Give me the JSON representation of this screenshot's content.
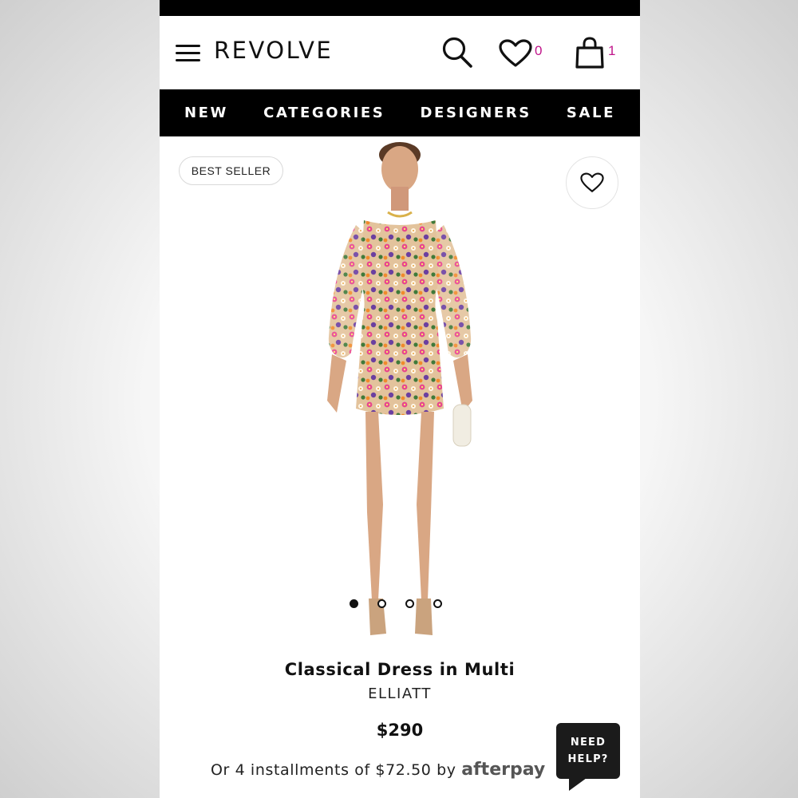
{
  "header": {
    "logo": "REVOLVE",
    "wishlist_count": "0",
    "cart_count": "1"
  },
  "nav": {
    "items": [
      "NEW",
      "CATEGORIES",
      "DESIGNERS",
      "SALE"
    ]
  },
  "product": {
    "badge": "BEST SELLER",
    "title": "Classical Dress in Multi",
    "brand": "ELLIATT",
    "price": "$290",
    "installments_text": "Or 4 installments of $72.50 by",
    "installments_provider": "afterpay",
    "carousel": {
      "total": 4,
      "active": 1
    }
  },
  "help": {
    "line1": "NEED",
    "line2": "HELP?"
  },
  "icons": {
    "menu": "hamburger-menu-icon",
    "search": "search-icon",
    "wishlist": "heart-icon",
    "cart": "shopping-bag-icon",
    "favorite": "heart-outline-icon"
  },
  "colors": {
    "accent_count": "#c0158a",
    "nav_bg": "#000000"
  }
}
